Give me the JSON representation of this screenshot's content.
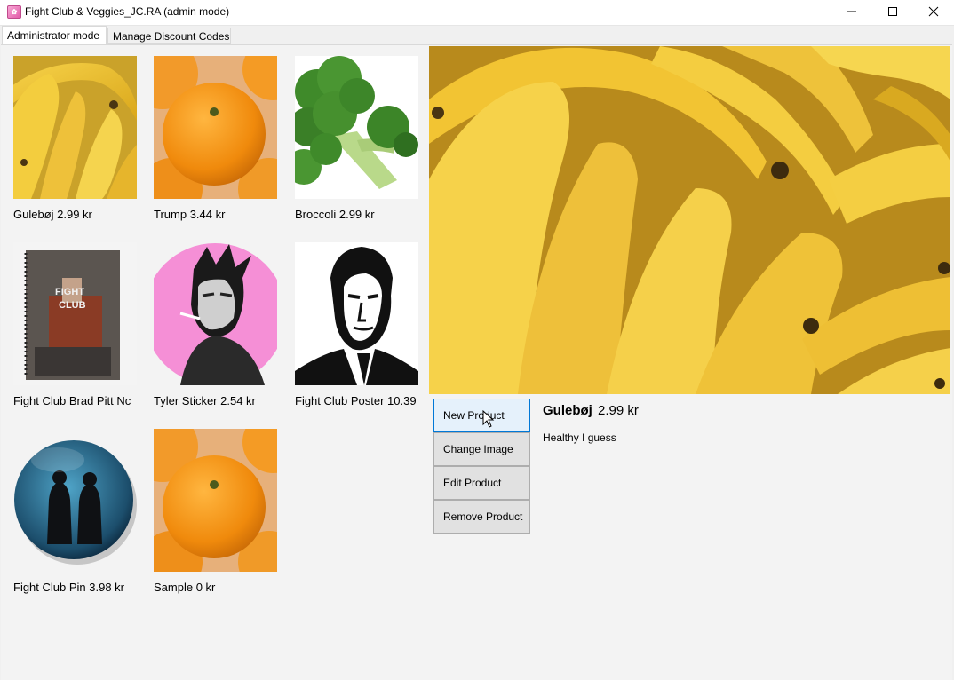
{
  "window": {
    "title": "Fight Club & Veggies_JC.RA (admin mode)",
    "icon": "app-icon"
  },
  "tabs": [
    {
      "label": "Administrator mode",
      "selected": true
    },
    {
      "label": "Manage Discount Codes",
      "selected": false
    }
  ],
  "products": [
    {
      "caption": "Gulebøj 2.99 kr",
      "image": "bananas"
    },
    {
      "caption": "Trump 3.44 kr",
      "image": "orange"
    },
    {
      "caption": "Broccoli 2.99 kr",
      "image": "broccoli"
    },
    {
      "caption": "Fight Club Brad Pitt Nc",
      "image": "fight-club-notebook"
    },
    {
      "caption": "Tyler Sticker 2.54 kr",
      "image": "tyler-sticker"
    },
    {
      "caption": "Fight Club Poster 10.39",
      "image": "fight-club-poster"
    },
    {
      "caption": "Fight Club Pin 3.98 kr",
      "image": "fight-club-pin"
    },
    {
      "caption": "Sample 0 kr",
      "image": "orange"
    }
  ],
  "notebook_text": {
    "fight": "FIGHT",
    "club": "CLUB"
  },
  "selected": {
    "name": "Gulebøj",
    "price": "2.99 kr",
    "description": "Healthy I guess",
    "image": "bananas"
  },
  "actions": {
    "new_product": "New Product",
    "change_image": "Change Image",
    "edit_product": "Edit Product",
    "remove_product": "Remove Product"
  },
  "colors": {
    "accent": "#0078d7",
    "hover_fill": "#e5f1fb",
    "sticker_pink": "#f58fd6",
    "banana": "#f2c433"
  }
}
